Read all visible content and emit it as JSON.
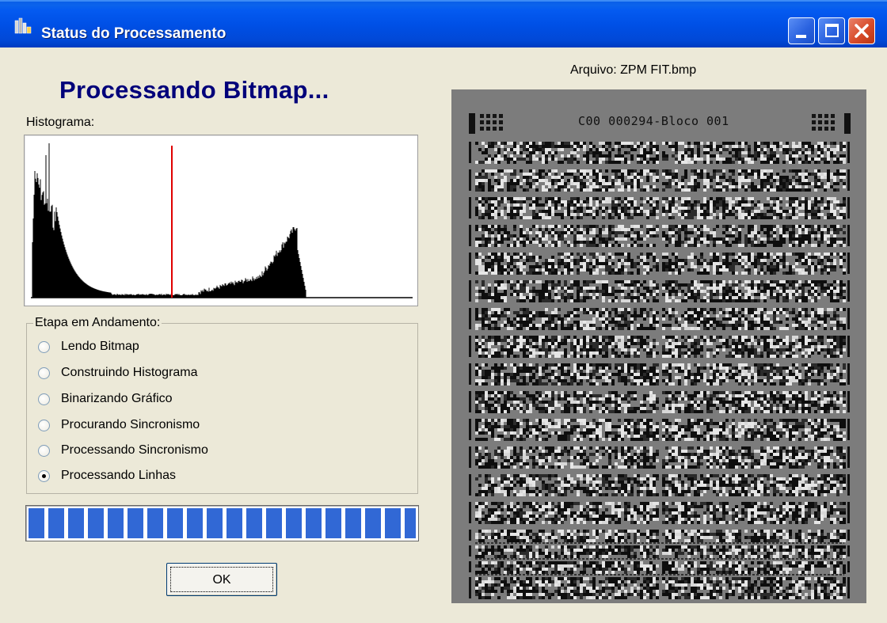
{
  "window": {
    "title": "Status do Processamento",
    "title_icon": "app-icon",
    "controls": [
      "minimize-icon",
      "maximize-icon",
      "close-icon"
    ]
  },
  "heading": "Processando Bitmap...",
  "histogram": {
    "label": "Histograma:",
    "threshold_color": "#e00000",
    "bar_color": "#000000"
  },
  "stage": {
    "legend": "Etapa em Andamento:",
    "options": [
      {
        "label": "Lendo Bitmap",
        "checked": false
      },
      {
        "label": "Construindo Histograma",
        "checked": false
      },
      {
        "label": "Binarizando Gráfico",
        "checked": false
      },
      {
        "label": "Procurando Sincronismo",
        "checked": false
      },
      {
        "label": "Processando Sincronismo",
        "checked": false
      },
      {
        "label": "Processando Linhas",
        "checked": true
      }
    ]
  },
  "progress": {
    "value": 1.0,
    "color": "#3168d5"
  },
  "ok_button": {
    "label": "OK"
  },
  "file": {
    "label": "Arquivo:  ZPM FIT.bmp"
  },
  "preview": {
    "header_text": "C00 000294-Bloco 001"
  }
}
